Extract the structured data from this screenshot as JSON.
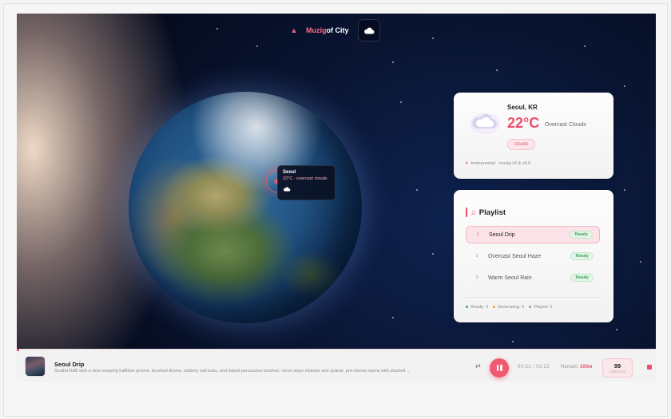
{
  "app": {
    "logo_main": "Muzig",
    "logo_suffix": "of City"
  },
  "map_popup": {
    "city": "Seoul",
    "condition": "22°C · overcast clouds"
  },
  "weather_card": {
    "location": "Seoul, KR",
    "temperature": "22°C",
    "description": "Overcast Clouds",
    "tag": "clouds",
    "footer": "Instrumental · muzig-v5 & v5.5"
  },
  "playlist": {
    "title": "Playlist",
    "tracks": [
      {
        "num": "1",
        "name": "Seoul Drip",
        "status": "Ready",
        "active": true
      },
      {
        "num": "2",
        "name": "Overcast Seoul Haze",
        "status": "Ready",
        "active": false
      },
      {
        "num": "3",
        "name": "Warm Seoul Rain",
        "status": "Ready",
        "active": false
      }
    ],
    "stats": {
      "ready": "Ready: 3",
      "generating": "Generating: 0",
      "played": "Played: 0"
    },
    "stat_colors": {
      "ready": "#3ea55a",
      "generating": "#f0a030",
      "played": "#9a9a9a"
    }
  },
  "player": {
    "title": "Seoul Drip",
    "subtitle": "Soulful R&B with a slow-swaying halftime groove, brushed drums, rubbery sub bass, and island-percussion touches; verse stays intimate and sparse, pre-chorus opens with stacked ...",
    "elapsed": "00:21",
    "separator": "/",
    "duration": "02:22",
    "remain_label": "Remain:",
    "remain_value": "100m",
    "credits_value": "99",
    "credits_label": "CREDITS",
    "progress": 0.15
  },
  "colors": {
    "accent": "#ee4f6a",
    "ready_green": "#3ea55a"
  }
}
